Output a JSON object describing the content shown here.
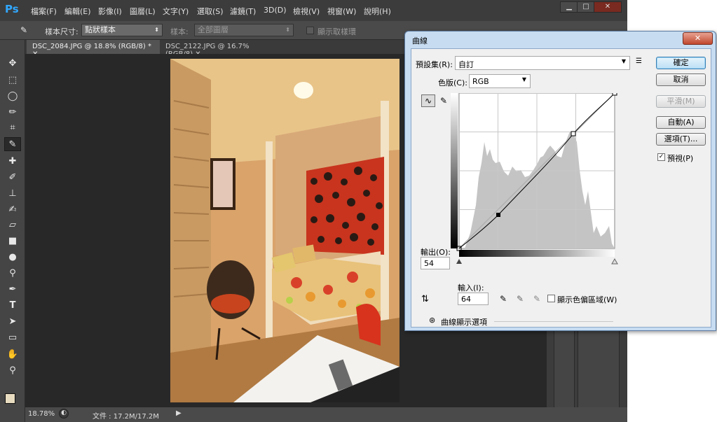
{
  "app": {
    "logo": "Ps"
  },
  "menu": [
    "檔案(F)",
    "編輯(E)",
    "影像(I)",
    "圖層(L)",
    "文字(Y)",
    "選取(S)",
    "濾鏡(T)",
    "3D(D)",
    "檢視(V)",
    "視窗(W)",
    "說明(H)"
  ],
  "window_buttons": {
    "minimize": "▁",
    "maximize": "□",
    "close": "✕"
  },
  "options": {
    "sample_size_label": "樣本尺寸:",
    "sample_size_value": "點狀樣本",
    "sample_label": "樣本:",
    "sample_value": "全部圖層",
    "show_ring_label": "顯示取樣環"
  },
  "tabs": [
    {
      "label": "DSC_2084.JPG @ 18.8% (RGB/8) *",
      "close": "✕"
    },
    {
      "label": "DSC_2122.JPG @ 16.7% (RGB/8)",
      "close": "✕"
    }
  ],
  "status": {
    "zoom": "18.78%",
    "doc": "文件 : 17.2M/17.2M"
  },
  "curves": {
    "title": "曲線",
    "close": "✕",
    "preset_label": "預設集(R):",
    "preset_value": "自訂",
    "channel_label": "色版(C):",
    "channel_value": "RGB",
    "output_label": "輸出(O):",
    "output_value": "54",
    "input_label": "輸入(I):",
    "input_value": "64",
    "show_clipping_label": "顯示色偏區域(W)",
    "display_options_label": "曲線顯示選項",
    "buttons": {
      "ok": "確定",
      "cancel": "取消",
      "smooth": "平滑(M)",
      "auto": "自動(A)",
      "options": "選項(T)...",
      "preview": "預視(P)"
    },
    "preview_checked": "✓"
  },
  "colors": {
    "accent": "#31a8ff",
    "ps_bg": "#535353",
    "dialog_frame": "#c7dcf1"
  }
}
